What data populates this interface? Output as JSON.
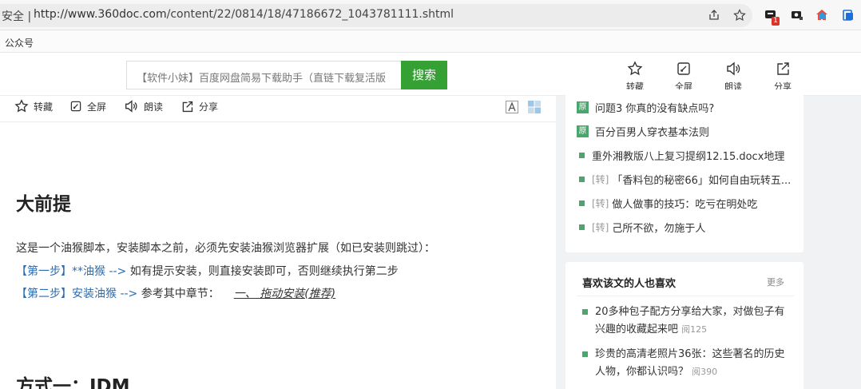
{
  "browser": {
    "secure_label": "安全 |",
    "url_host": "http://www.360doc.com",
    "url_path": "/content/22/0814/18/47186672_1043781111.shtml",
    "extension_badge": "1",
    "bookmark": "公众号"
  },
  "header": {
    "search_placeholder": "【软件小妹】百度网盘简易下载助手（直链下载复活版",
    "search_button": "搜索",
    "tools": [
      "转藏",
      "全屏",
      "朗读",
      "分享"
    ]
  },
  "article": {
    "tools": [
      "转藏",
      "全屏",
      "朗读",
      "分享"
    ],
    "heading1": "大前提",
    "intro": "这是一个油猴脚本，安装脚本之前，必须先安装油猴浏览器扩展（如已安装则跳过）：",
    "step1_label": "【第一步】**油猴 -->",
    "step1_text": " 如有提示安装，则直接安装即可，否则继续执行第二步",
    "step2_label": "【第二步】安装油猴 -->",
    "step2_text": " 参考其中章节：",
    "step2_link": "一、 拖动安装(推荐)",
    "heading2": "方式一：IDM"
  },
  "sidebar": {
    "yuan_tag": "原",
    "zhuan_tag": "[转]",
    "items": [
      {
        "tag": "原",
        "text": "问题3 你真的没有缺点吗?"
      },
      {
        "tag": "原",
        "text": "百分百男人穿衣基本法则"
      },
      {
        "tag": "",
        "text": "重外湘教版八上复习提纲12.15.docx地理"
      },
      {
        "tag": "[转]",
        "text": "「香料包的秘密66」如何自由玩转五..."
      },
      {
        "tag": "[转]",
        "text": "做人做事的技巧：吃亏在明处吃"
      },
      {
        "tag": "[转]",
        "text": "己所不欲，勿施于人"
      }
    ],
    "panel_title": "喜欢该文的人也喜欢",
    "panel_more": "更多",
    "recommendations": [
      {
        "text": "20多种包子配方分享给大家，对做包子有兴趣的收藏起来吧",
        "reads": "阅125"
      },
      {
        "text": "珍贵的高清老照片36张：这些著名的历史人物，你都认识吗？",
        "reads": "阅390"
      }
    ]
  },
  "colors": {
    "accent_green": "#35a033",
    "tag_green": "#4aa66c",
    "link_blue": "#2b6cb0"
  }
}
